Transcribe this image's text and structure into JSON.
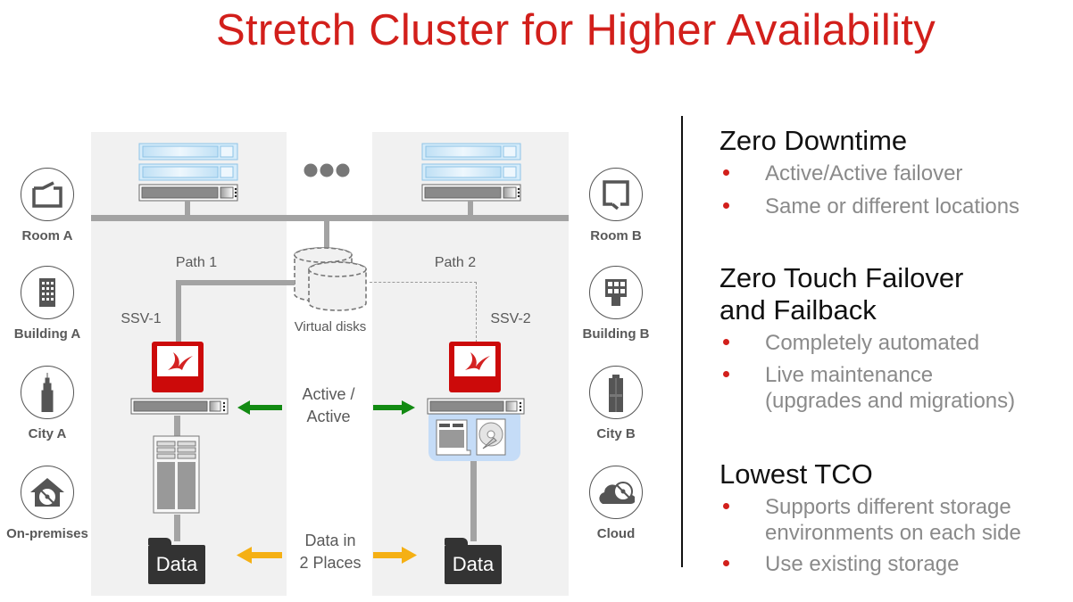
{
  "title": "Stretch Cluster for Higher Availability",
  "colors": {
    "accent_red": "#d21f1b",
    "active_arrow": "#128a12",
    "data_arrow": "#f5b014",
    "panel_bg": "#f1f1f1",
    "line_gray": "#a3a3a3"
  },
  "diagram": {
    "ellipsis_label": "more servers",
    "path_labels": [
      "Path 1",
      "Path 2"
    ],
    "node_labels": [
      "SSV-1",
      "SSV-2"
    ],
    "virtual_disks_label": "Virtual disks",
    "active_label_line1": "Active /",
    "active_label_line2": "Active",
    "data_label_line1": "Data in",
    "data_label_line2": "2 Places",
    "data_folder_left": "Data",
    "data_folder_right": "Data",
    "left_locations": [
      {
        "label": "Room A",
        "icon": "room-icon"
      },
      {
        "label": "Building A",
        "icon": "building-icon"
      },
      {
        "label": "City A",
        "icon": "skyscraper-icon"
      },
      {
        "label": "On-premises",
        "icon": "home-disk-icon"
      }
    ],
    "right_locations": [
      {
        "label": "Room B",
        "icon": "room-icon"
      },
      {
        "label": "Building B",
        "icon": "building-icon"
      },
      {
        "label": "City B",
        "icon": "tower-icon"
      },
      {
        "label": "Cloud",
        "icon": "cloud-disk-icon"
      }
    ]
  },
  "features": [
    {
      "heading_line1": "Zero Downtime",
      "heading_line2": "",
      "bullets": [
        "Active/Active failover",
        "Same or different locations"
      ]
    },
    {
      "heading_line1": "Zero Touch Failover",
      "heading_line2": "and Failback",
      "bullets": [
        "Completely automated",
        "Live maintenance",
        "(upgrades and migrations)"
      ]
    },
    {
      "heading_line1": "Lowest TCO",
      "heading_line2": "",
      "bullets": [
        "Supports different storage",
        "environments on each side",
        "Use existing storage"
      ]
    }
  ]
}
